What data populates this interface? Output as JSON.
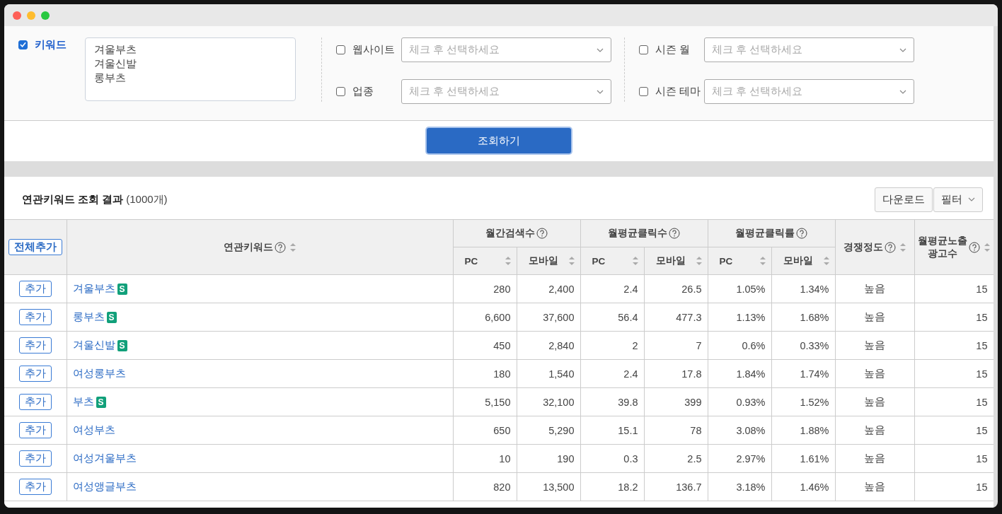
{
  "keyword_filter": {
    "label": "키워드",
    "checked": true,
    "value": "겨울부츠\n겨울신발\n롱부츠"
  },
  "select_filters": [
    [
      {
        "label": "웹사이트",
        "checked": false,
        "placeholder": "체크 후 선택하세요"
      },
      {
        "label": "업종",
        "checked": false,
        "placeholder": "체크 후 선택하세요"
      }
    ],
    [
      {
        "label": "시즌 월",
        "checked": false,
        "placeholder": "체크 후 선택하세요"
      },
      {
        "label": "시즌 테마",
        "checked": false,
        "placeholder": "체크 후 선택하세요"
      }
    ]
  ],
  "search_button": "조회하기",
  "results": {
    "title": "연관키워드 조회 결과",
    "count": "(1000개)",
    "download_button": "다운로드",
    "filter_button": "필터",
    "columns": [
      {
        "kind": "button",
        "label": "전체추가"
      },
      {
        "kind": "header",
        "label": "연관키워드",
        "help": true,
        "sortable": true
      },
      {
        "kind": "header",
        "label": "월간검색수",
        "help": true,
        "sortable": false,
        "colspan": 2,
        "children": [
          {
            "label": "PC",
            "sortable": true
          },
          {
            "label": "모바일",
            "sortable": true
          }
        ]
      },
      {
        "kind": "header",
        "label": "월평균클릭수",
        "help": true,
        "sortable": false,
        "colspan": 2,
        "children": [
          {
            "label": "PC",
            "sortable": true
          },
          {
            "label": "모바일",
            "sortable": true
          }
        ]
      },
      {
        "kind": "header",
        "label": "월평균클릭률",
        "help": true,
        "sortable": false,
        "colspan": 2,
        "children": [
          {
            "label": "PC",
            "sortable": true
          },
          {
            "label": "모바일",
            "sortable": true
          }
        ]
      },
      {
        "kind": "header",
        "label": "경쟁정도",
        "help": true,
        "sortable": true
      },
      {
        "kind": "header",
        "label": "월평균노출\n광고수",
        "help": true,
        "sortable": true
      }
    ],
    "rows": [
      {
        "badge": "S",
        "cells": [
          "추가",
          "겨울부츠",
          "280",
          "2,400",
          "2.4",
          "26.5",
          "1.05%",
          "1.34%",
          "높음",
          "15"
        ]
      },
      {
        "badge": "S",
        "cells": [
          "추가",
          "롱부츠",
          "6,600",
          "37,600",
          "56.4",
          "477.3",
          "1.13%",
          "1.68%",
          "높음",
          "15"
        ]
      },
      {
        "badge": "S",
        "cells": [
          "추가",
          "겨울신발",
          "450",
          "2,840",
          "2",
          "7",
          "0.6%",
          "0.33%",
          "높음",
          "15"
        ]
      },
      {
        "cells": [
          "추가",
          "여성롱부츠",
          "180",
          "1,540",
          "2.4",
          "17.8",
          "1.84%",
          "1.74%",
          "높음",
          "15"
        ]
      },
      {
        "badge": "S",
        "cells": [
          "추가",
          "부츠",
          "5,150",
          "32,100",
          "39.8",
          "399",
          "0.93%",
          "1.52%",
          "높음",
          "15"
        ]
      },
      {
        "cells": [
          "추가",
          "여성부츠",
          "650",
          "5,290",
          "15.1",
          "78",
          "3.08%",
          "1.88%",
          "높음",
          "15"
        ]
      },
      {
        "cells": [
          "추가",
          "여성겨울부츠",
          "10",
          "190",
          "0.3",
          "2.5",
          "2.97%",
          "1.61%",
          "높음",
          "15"
        ]
      },
      {
        "cells": [
          "추가",
          "여성앵글부츠",
          "820",
          "13,500",
          "18.2",
          "136.7",
          "3.18%",
          "1.46%",
          "높음",
          "15"
        ]
      }
    ]
  }
}
